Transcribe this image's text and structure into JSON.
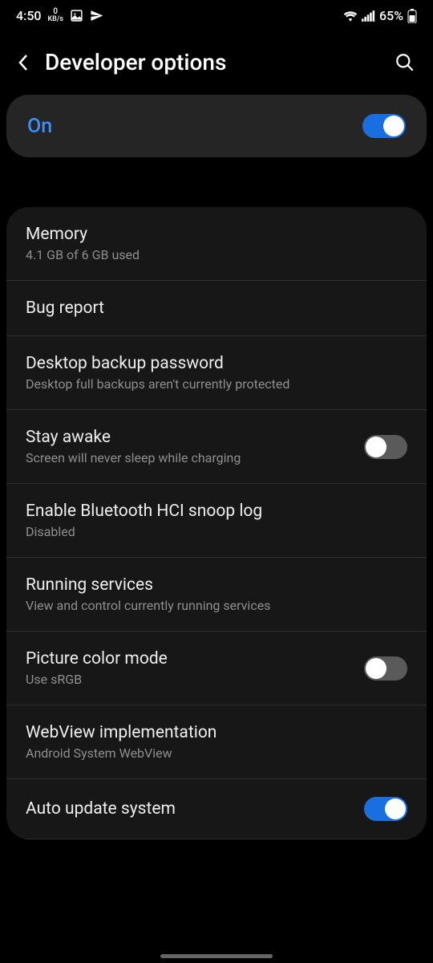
{
  "status": {
    "time": "4:50",
    "kbs_top": "0",
    "kbs_bottom": "KB/s",
    "battery": "65%"
  },
  "header": {
    "title": "Developer options"
  },
  "master": {
    "label": "On",
    "state": "on"
  },
  "settings": [
    {
      "title": "Memory",
      "sub": "4.1 GB of 6 GB used",
      "toggle": null
    },
    {
      "title": "Bug report",
      "sub": "",
      "toggle": null
    },
    {
      "title": "Desktop backup password",
      "sub": "Desktop full backups aren't currently protected",
      "toggle": null
    },
    {
      "title": "Stay awake",
      "sub": "Screen will never sleep while charging",
      "toggle": "off"
    },
    {
      "title": "Enable Bluetooth HCI snoop log",
      "sub": "Disabled",
      "toggle": null
    },
    {
      "title": "Running services",
      "sub": "View and control currently running services",
      "toggle": null
    },
    {
      "title": "Picture color mode",
      "sub": "Use sRGB",
      "toggle": "off"
    },
    {
      "title": "WebView implementation",
      "sub": "Android System WebView",
      "toggle": null
    },
    {
      "title": "Auto update system",
      "sub": "",
      "toggle": "on"
    }
  ]
}
